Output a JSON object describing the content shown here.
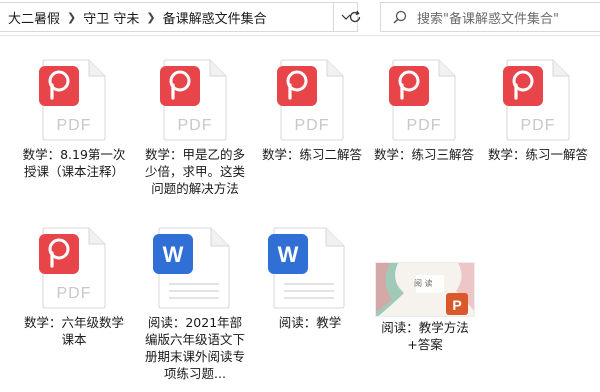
{
  "breadcrumb": {
    "items": [
      "大二暑假",
      "守卫 守未",
      "备课解惑文件集合"
    ]
  },
  "search": {
    "placeholder": "搜索\"备课解惑文件集合\""
  },
  "icons": {
    "pdf_badge": "PDF",
    "word_badge": "W",
    "pdf_brand_color": "#e8454a",
    "word_brand_color": "#2f6fd6"
  },
  "files": [
    {
      "type": "pdf",
      "name": "数学：8.19第一次授课（课本注释）"
    },
    {
      "type": "pdf",
      "name": "数学：甲是乙的多少倍，求甲。这类问题的解决方法"
    },
    {
      "type": "pdf",
      "name": "数学：练习二解答"
    },
    {
      "type": "pdf",
      "name": "数学：练习三解答"
    },
    {
      "type": "pdf",
      "name": "数学：练习一解答"
    },
    {
      "type": "pdf",
      "name": "数学：六年级数学课本"
    },
    {
      "type": "word",
      "name": "阅读：2021年部编版六年级语文下册期末课外阅读专项练习题..."
    },
    {
      "type": "word",
      "name": "阅读：教学"
    },
    {
      "type": "ppt",
      "name": "阅读：教学方法+答案",
      "thumb_title": "阅 读"
    }
  ]
}
